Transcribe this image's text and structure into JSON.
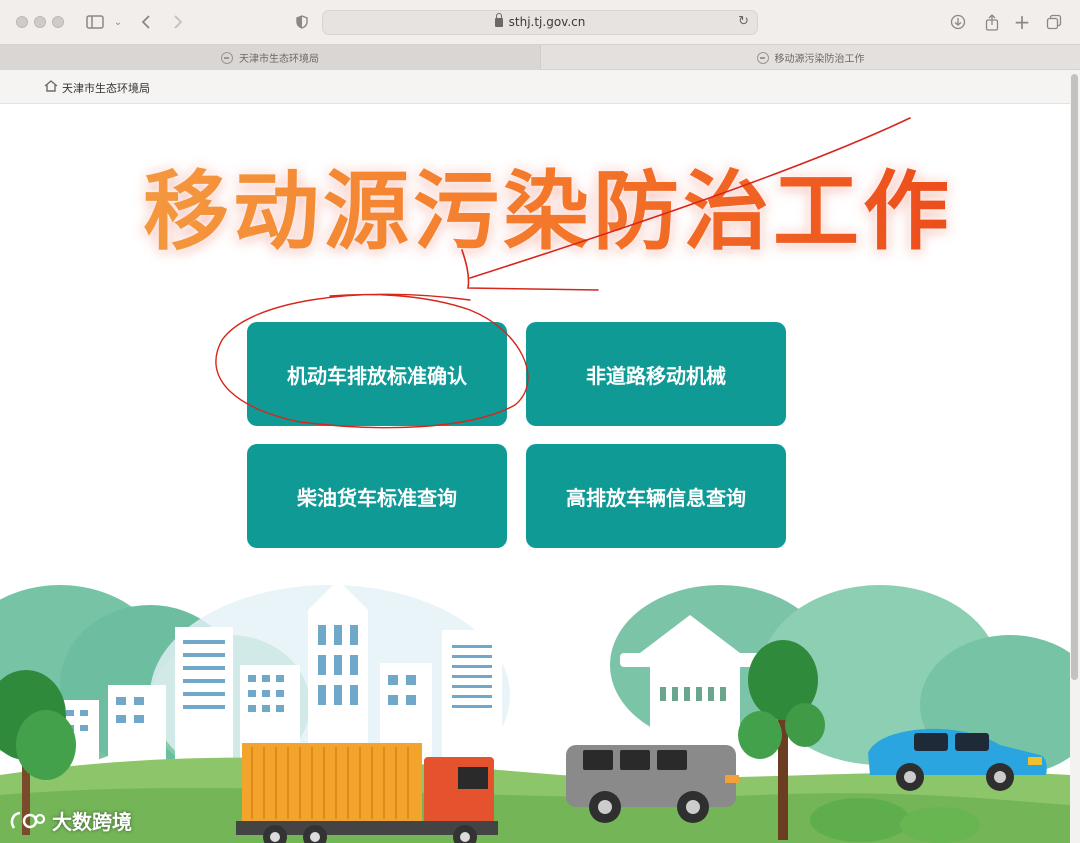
{
  "browser": {
    "url": "sthj.tj.gov.cn",
    "tabs": [
      {
        "label": "天津市生态环境局",
        "active": true
      },
      {
        "label": "移动源污染防治工作",
        "active": false
      }
    ]
  },
  "site": {
    "home_label": "天津市生态环境局"
  },
  "page": {
    "title": "移动源污染防治工作",
    "buttons": [
      {
        "label": "机动车排放标准确认"
      },
      {
        "label": "非道路移动机械"
      },
      {
        "label": "柴油货车标准查询"
      },
      {
        "label": "高排放车辆信息查询"
      }
    ],
    "accent_color": "#0f9a95",
    "annotation_color": "#d8261c"
  },
  "watermark": {
    "text": "大数跨境"
  }
}
